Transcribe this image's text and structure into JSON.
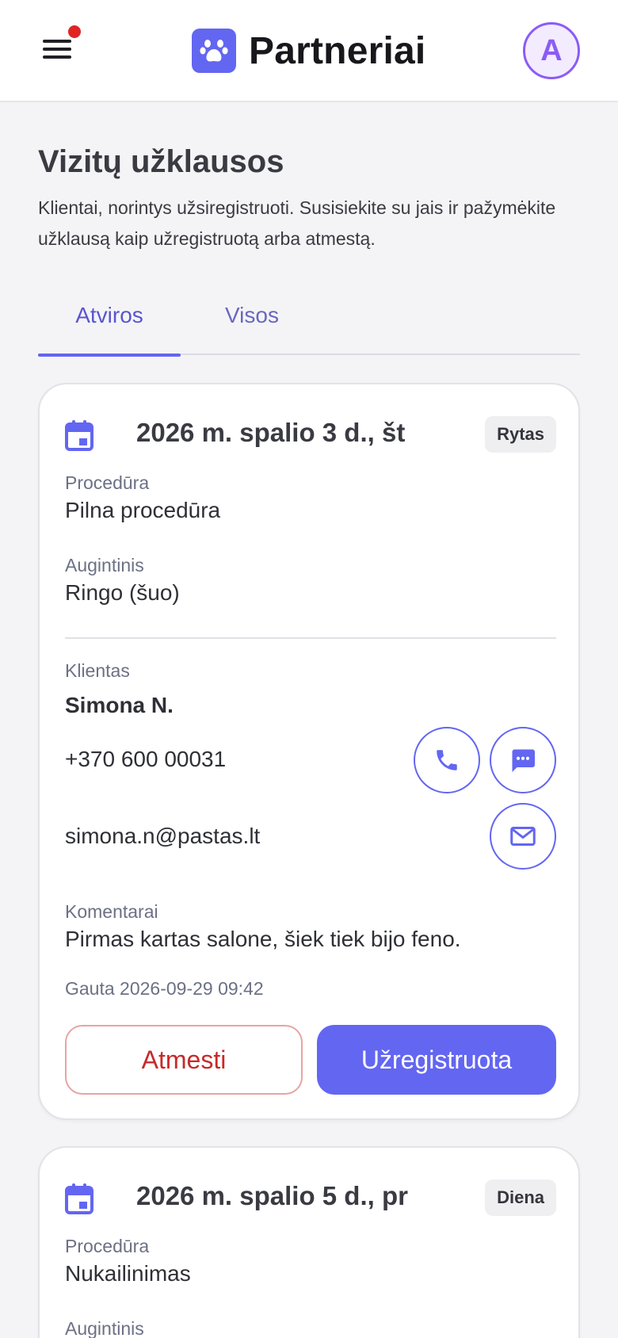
{
  "header": {
    "title": "Partneriai",
    "avatar_letter": "A",
    "menu_icon": "hamburger-menu-icon",
    "logo_icon": "paw-icon",
    "has_notification": true,
    "accent_color": "#6366f1"
  },
  "page": {
    "title": "Vizitų užklausos",
    "subtitle": "Klientai, norintys užsiregistruoti. Susisiekite su jais ir pažymėkite užklausą kaip užregistruotą arba atmestą."
  },
  "tabs": [
    {
      "label": "Atviros",
      "active": true
    },
    {
      "label": "Visos",
      "active": false
    }
  ],
  "requests": [
    {
      "date": "2026 m. spalio 3 d., št",
      "slot": "Rytas",
      "procedure_label": "Procedūra",
      "procedure": "Pilna procedūra",
      "pet_label": "Augintinis",
      "pet": "Ringo (šuo)",
      "client_label": "Klientas",
      "client": "Simona N.",
      "phone": "+370 600 00031",
      "email": "simona.n@pastas.lt",
      "comments_label": "Komentarai",
      "comments": "Pirmas kartas salone, šiek tiek bijo feno.",
      "received": "Gauta 2026-09-29 09:42",
      "reject_label": "Atmesti",
      "confirm_label": "Užregistruota"
    },
    {
      "date": "2026 m. spalio 5 d., pr",
      "slot": "Diena",
      "procedure_label": "Procedūra",
      "procedure": "Nukailinimas",
      "pet_label": "Augintinis"
    }
  ]
}
